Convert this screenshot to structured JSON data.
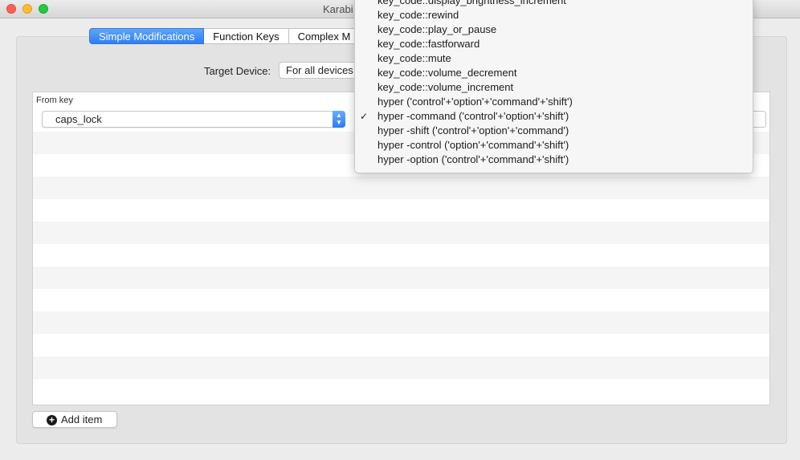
{
  "window": {
    "title": "Karabi"
  },
  "tabs": [
    {
      "label": "Simple Modifications",
      "active": true
    },
    {
      "label": "Function Keys",
      "active": false
    },
    {
      "label": "Complex M",
      "active": false
    }
  ],
  "target_device": {
    "label": "Target Device:",
    "value": "For all devices"
  },
  "table": {
    "from_header": "From key",
    "from_value": "caps_lock"
  },
  "add_button": {
    "label": "Add item",
    "icon": "plus-circle-icon"
  },
  "dropdown": {
    "items": [
      {
        "label": "key_code::display_brightness_increment",
        "checked": false
      },
      {
        "label": "key_code::rewind",
        "checked": false
      },
      {
        "label": "key_code::play_or_pause",
        "checked": false
      },
      {
        "label": "key_code::fastforward",
        "checked": false
      },
      {
        "label": "key_code::mute",
        "checked": false
      },
      {
        "label": "key_code::volume_decrement",
        "checked": false
      },
      {
        "label": "key_code::volume_increment",
        "checked": false
      },
      {
        "label": "hyper ('control'+'option'+'command'+'shift')",
        "checked": false
      },
      {
        "label": "hyper -command ('control'+'option'+'shift')",
        "checked": true
      },
      {
        "label": "hyper -shift ('control'+'option'+'command')",
        "checked": false
      },
      {
        "label": "hyper -control ('option'+'command'+'shift')",
        "checked": false
      },
      {
        "label": "hyper -option ('control'+'command'+'shift')",
        "checked": false
      }
    ],
    "check_glyph": "✓"
  },
  "colors": {
    "accent": "#2e7ef4",
    "close": "#fc5f57",
    "minimize": "#fdbc2e",
    "maximize": "#28c840"
  }
}
